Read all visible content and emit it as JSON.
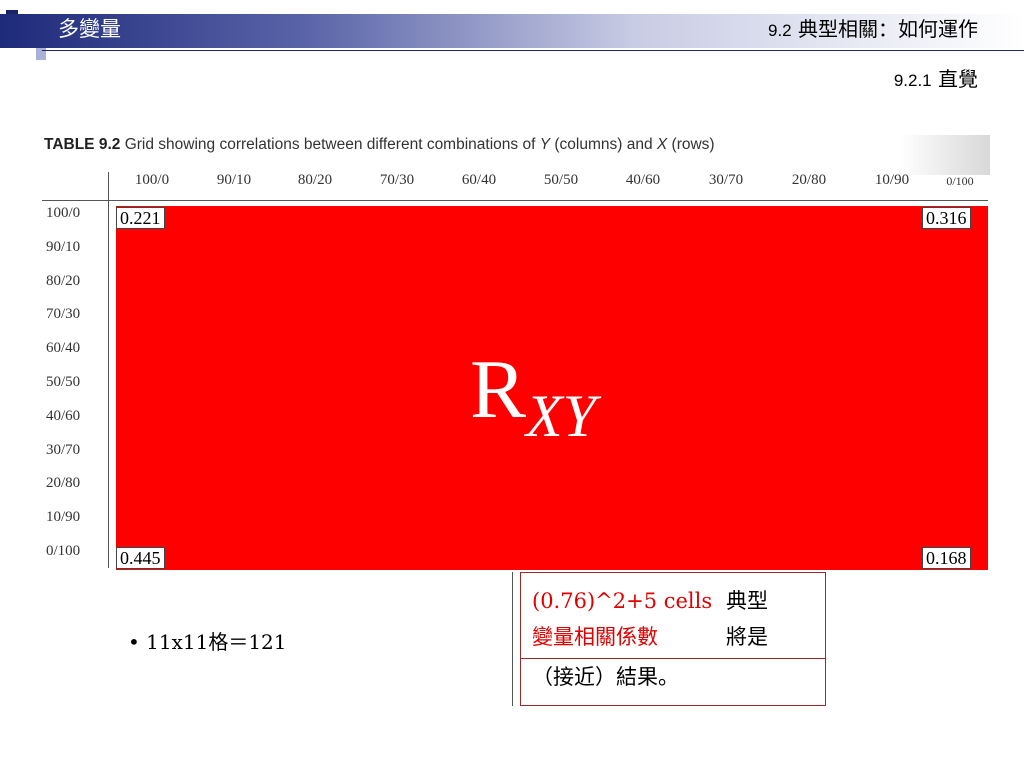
{
  "header": {
    "title": "多變量",
    "section_num": "9.2",
    "section_title": "典型相關：如何運作",
    "sub_num": "9.2.1",
    "sub_title": "直覺"
  },
  "table": {
    "caption_bold": "TABLE 9.2",
    "caption_text": "Grid showing correlations between different combinations of",
    "caption_y": "Y",
    "caption_mid": "(columns) and",
    "caption_x": "X",
    "caption_end": "(rows)",
    "columns": [
      "100/0",
      "90/10",
      "80/20",
      "70/30",
      "60/40",
      "50/50",
      "40/60",
      "30/70",
      "20/80",
      "10/90",
      "0/100"
    ],
    "rows": [
      "100/0",
      "90/10",
      "80/20",
      "70/30",
      "60/40",
      "50/50",
      "40/60",
      "30/70",
      "20/80",
      "10/90",
      "0/100"
    ],
    "corners": {
      "top_left": "0.221",
      "top_right": "0.316",
      "bottom_left": "0.445",
      "bottom_right": "0.168"
    },
    "block_symbol": "R",
    "block_subscript": "XY"
  },
  "bullet": {
    "text": "• 11x11格＝121"
  },
  "note": {
    "line1_red": "(0.76)^2+5 cells",
    "line1_black": "典型",
    "line2_red": "變量相關係數",
    "line2_black": "將是",
    "line3": "（接近）結果。"
  },
  "colors": {
    "accent_red": "#ff0000",
    "header_navy": "#1e2a7a"
  }
}
